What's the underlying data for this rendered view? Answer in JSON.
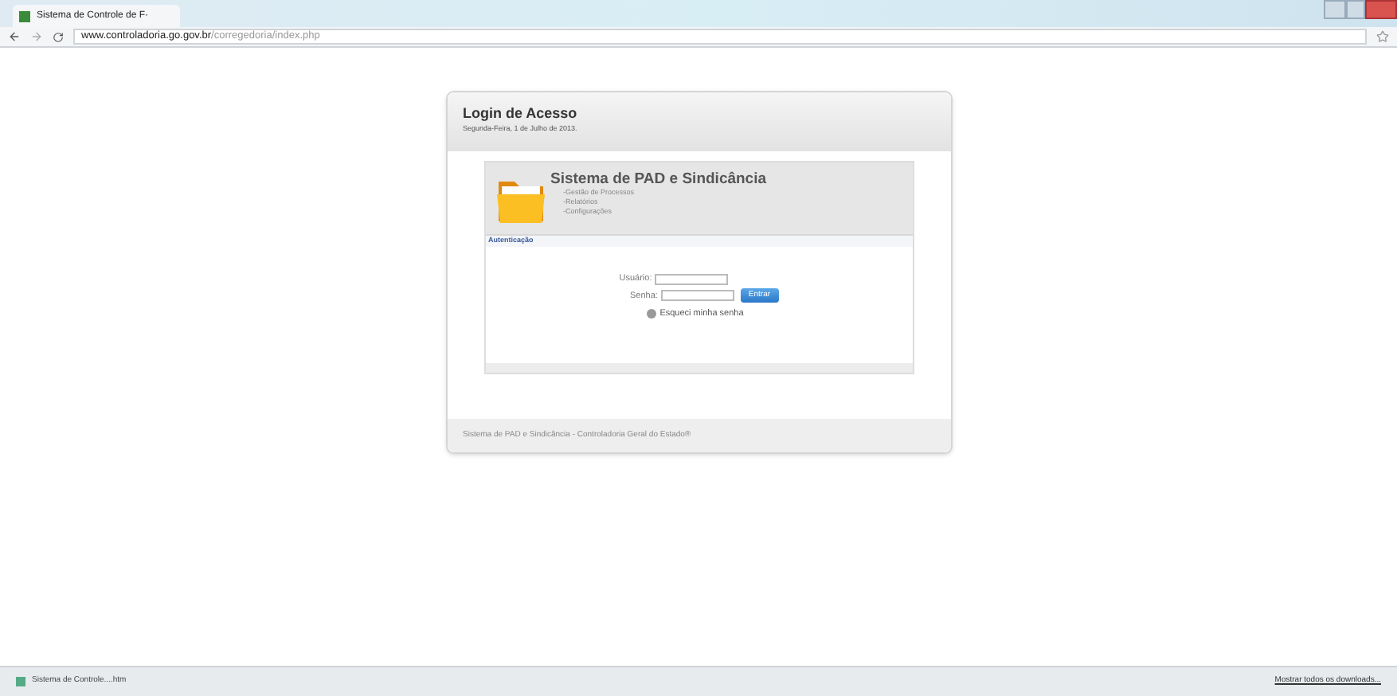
{
  "browser": {
    "tab_title": "Sistema de Controle de F·",
    "url_host": "www.controladoria.go.gov.br",
    "url_path": "/corregedoria/index.php"
  },
  "login": {
    "title": "Login de Acesso",
    "date": "Segunda-Feira, 1 de Julho de 2013.",
    "system_title": "Sistema de PAD e Sindicância",
    "menu": [
      "-Gestão de Processos",
      "-Relatórios",
      "-Configurações"
    ],
    "section": "Autenticação",
    "user_label": "Usuário:",
    "password_label": "Senha:",
    "submit": "Entrar",
    "forgot": "Esqueci minha senha",
    "footer": "Sistema de PAD e Sindicância - Controladoria Geral do Estado®"
  },
  "downloads": {
    "file": "Sistema de Controle....htm",
    "show_all": "Mostrar todos os downloads..."
  }
}
